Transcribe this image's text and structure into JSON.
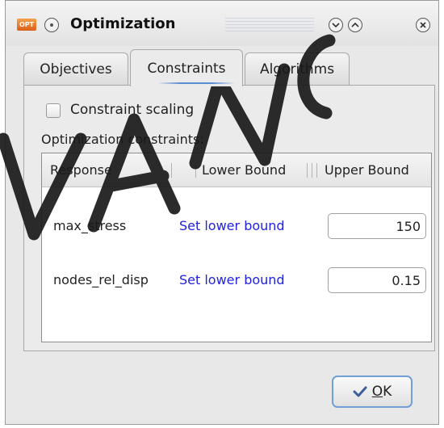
{
  "window": {
    "app_icon_text": "OPT",
    "title": "Optimization"
  },
  "tabs": [
    {
      "label": "Objectives",
      "active": false
    },
    {
      "label": "Constraints",
      "active": true
    },
    {
      "label": "Algorithms",
      "active": false
    }
  ],
  "constraints": {
    "scaling_label": "Constraint scaling",
    "scaling_checked": false,
    "group_label": "Optimization constraints:",
    "columns": [
      "Response",
      "Lower Bound",
      "Upper Bound"
    ],
    "rows": [
      {
        "response": "max_stress",
        "lower": "Set lower bound",
        "upper": "150"
      },
      {
        "response": "nodes_rel_disp",
        "lower": "Set lower bound",
        "upper": "0.15"
      }
    ]
  },
  "footer": {
    "ok_label": "K",
    "ok_mnemonic": "O"
  },
  "colors": {
    "link": "#2222dd",
    "focus_border": "#6fa0d6",
    "watermark": "#1a1a1a"
  },
  "icons": [
    "app-logo-icon",
    "menu-circle-icon",
    "collapse-icon",
    "expand-icon",
    "close-icon",
    "checkmark-icon"
  ]
}
